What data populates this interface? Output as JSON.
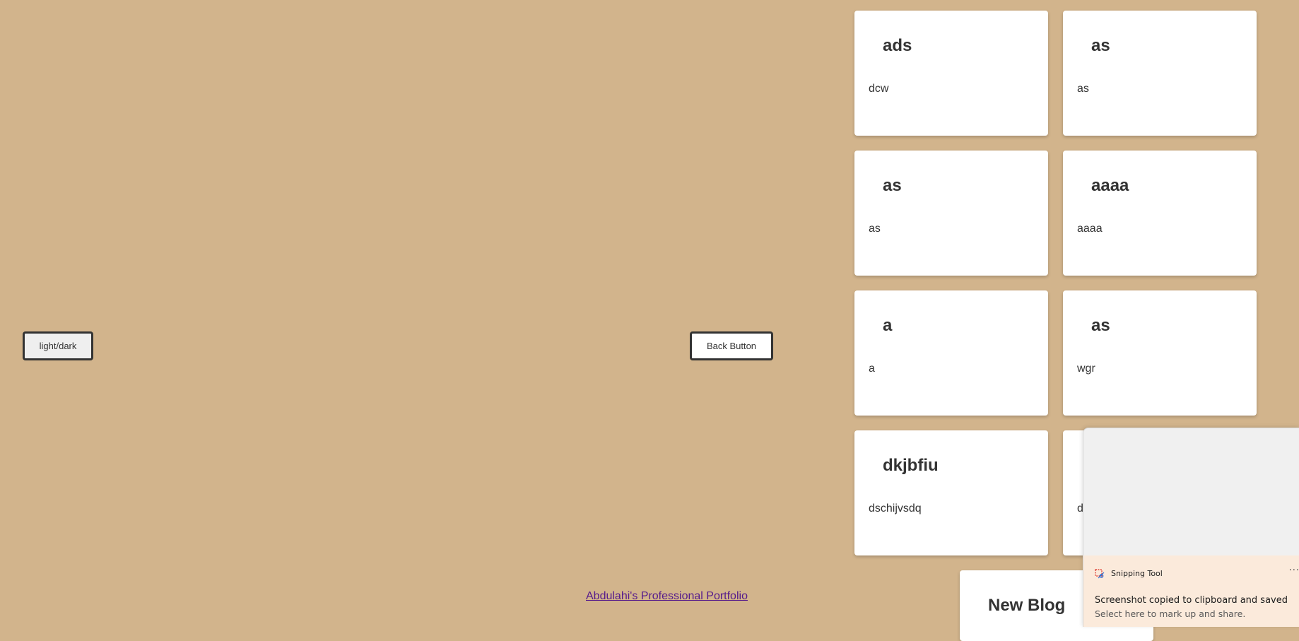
{
  "theme_button": {
    "label": "light/dark"
  },
  "back_button": {
    "label": "Back Button"
  },
  "footer": {
    "portfolio_link": "Abdulahi's Professional Portfolio"
  },
  "posts": [
    {
      "title": "ads",
      "body": "dcw"
    },
    {
      "title": "as",
      "body": "as"
    },
    {
      "title": "as",
      "body": "as"
    },
    {
      "title": "aaaa",
      "body": "aaaa"
    },
    {
      "title": "a",
      "body": "a"
    },
    {
      "title": "as",
      "body": "wgr"
    },
    {
      "title": "dkjbfiu",
      "body": "dschijvsdq"
    },
    {
      "title": "",
      "body": "d"
    }
  ],
  "new_blog": {
    "title": "New Blog"
  },
  "notification": {
    "app_name": "Snipping Tool",
    "title": "Screenshot copied to clipboard and saved",
    "subtitle": "Select here to mark up and share.",
    "more_label": "···"
  },
  "colors": {
    "page_background": "#d2b48c",
    "card_background": "#ffffff",
    "link": "#551a8b",
    "toast_background": "#f0f0f0",
    "toast_body": "#fbeadb"
  }
}
